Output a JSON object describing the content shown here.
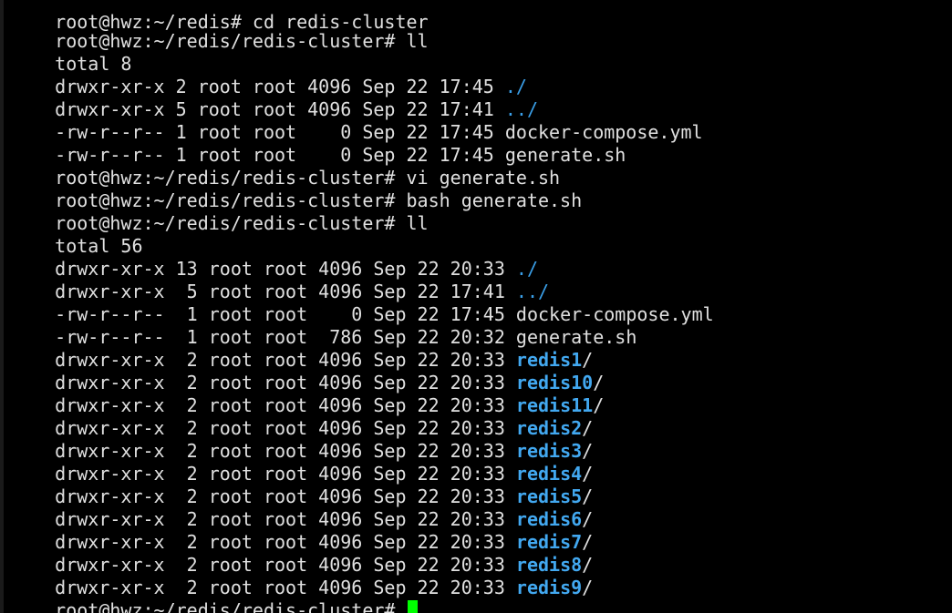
{
  "terminal": {
    "colors": {
      "background": "#000000",
      "text": "#e0e0e0",
      "directory": "#3a9fe8",
      "cursor": "#00ff00"
    },
    "top_cut": "root@hwz:~/redis# cd redis-cluster",
    "prompt": "root@hwz:~/redis/redis-cluster# ",
    "cmd1": "ll",
    "total1": "total 8",
    "listing1": [
      {
        "meta": "drwxr-xr-x 2 root root 4096 Sep 22 17:45 ",
        "name": "./",
        "kind": "dir"
      },
      {
        "meta": "drwxr-xr-x 5 root root 4096 Sep 22 17:41 ",
        "name": "../",
        "kind": "dir"
      },
      {
        "meta": "-rw-r--r-- 1 root root    0 Sep 22 17:45 ",
        "name": "docker-compose.yml",
        "kind": "file"
      },
      {
        "meta": "-rw-r--r-- 1 root root    0 Sep 22 17:45 ",
        "name": "generate.sh",
        "kind": "file"
      }
    ],
    "cmd2": "vi generate.sh",
    "cmd3": "bash generate.sh",
    "cmd4": "ll",
    "total2": "total 56",
    "listing2_top": [
      {
        "meta": "drwxr-xr-x 13 root root 4096 Sep 22 20:33 ",
        "name": "./",
        "kind": "dir"
      },
      {
        "meta": "drwxr-xr-x  5 root root 4096 Sep 22 17:41 ",
        "name": "../",
        "kind": "dir"
      },
      {
        "meta": "-rw-r--r--  1 root root    0 Sep 22 17:45 ",
        "name": "docker-compose.yml",
        "kind": "file"
      },
      {
        "meta": "-rw-r--r--  1 root root  786 Sep 22 20:32 ",
        "name": "generate.sh",
        "kind": "file"
      }
    ],
    "listing2_dirs": [
      {
        "meta": "drwxr-xr-x  2 root root 4096 Sep 22 20:33 ",
        "name": "redis1",
        "suffix": "/"
      },
      {
        "meta": "drwxr-xr-x  2 root root 4096 Sep 22 20:33 ",
        "name": "redis10",
        "suffix": "/"
      },
      {
        "meta": "drwxr-xr-x  2 root root 4096 Sep 22 20:33 ",
        "name": "redis11",
        "suffix": "/"
      },
      {
        "meta": "drwxr-xr-x  2 root root 4096 Sep 22 20:33 ",
        "name": "redis2",
        "suffix": "/"
      },
      {
        "meta": "drwxr-xr-x  2 root root 4096 Sep 22 20:33 ",
        "name": "redis3",
        "suffix": "/"
      },
      {
        "meta": "drwxr-xr-x  2 root root 4096 Sep 22 20:33 ",
        "name": "redis4",
        "suffix": "/"
      },
      {
        "meta": "drwxr-xr-x  2 root root 4096 Sep 22 20:33 ",
        "name": "redis5",
        "suffix": "/"
      },
      {
        "meta": "drwxr-xr-x  2 root root 4096 Sep 22 20:33 ",
        "name": "redis6",
        "suffix": "/"
      },
      {
        "meta": "drwxr-xr-x  2 root root 4096 Sep 22 20:33 ",
        "name": "redis7",
        "suffix": "/"
      },
      {
        "meta": "drwxr-xr-x  2 root root 4096 Sep 22 20:33 ",
        "name": "redis8",
        "suffix": "/"
      },
      {
        "meta": "drwxr-xr-x  2 root root 4096 Sep 22 20:33 ",
        "name": "redis9",
        "suffix": "/"
      }
    ]
  }
}
